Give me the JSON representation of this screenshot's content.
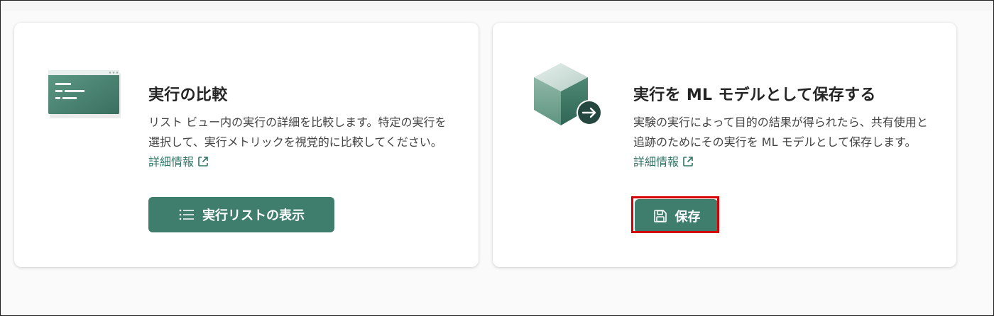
{
  "cards": [
    {
      "title": "実行の比較",
      "description": "リスト ビュー内の実行の詳細を比較します。特定の実行を選択して、実行メトリックを視覚的に比較してください。",
      "link_label": "詳細情報",
      "button_label": "実行リストの表示",
      "button_icon": "list-icon",
      "illustration": "browser-window-icon"
    },
    {
      "title": "実行を ML モデルとして保存する",
      "description": "実験の実行によって目的の結果が得られたら、共有使用と追跡のためにその実行を ML モデルとして保存します。",
      "link_label": "詳細情報",
      "button_label": "保存",
      "button_icon": "save-icon",
      "illustration": "cube-arrow-icon"
    }
  ],
  "colors": {
    "accent": "#3f7d6c",
    "link": "#2e7564",
    "highlight": "#d50000"
  }
}
